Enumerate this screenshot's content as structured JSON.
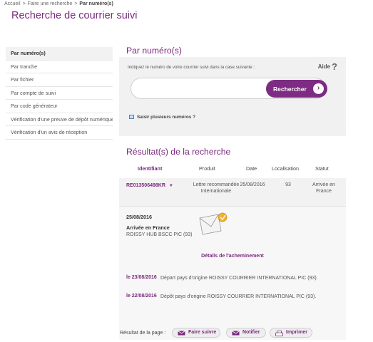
{
  "breadcrumb": {
    "items": [
      "Accueil",
      "Faire une recherche",
      "Par numéro(s)"
    ],
    "separator": ">"
  },
  "page": {
    "title": "Recherche de courrier suivi"
  },
  "sidebar": {
    "items": [
      {
        "label": "Par numéro(s)",
        "active": true
      },
      {
        "label": "Par tranche",
        "active": false
      },
      {
        "label": "Par fichier",
        "active": false
      },
      {
        "label": "Par compte de suivi",
        "active": false
      },
      {
        "label": "Par code générateur",
        "active": false
      },
      {
        "label": "Vérification d'une preuve de dépôt numérique",
        "active": false
      },
      {
        "label": "Vérification d'un avis de réception",
        "active": false
      }
    ]
  },
  "search": {
    "title": "Par numéro(s)",
    "hint": "Indiquez le numéro de votre courrier suivi dans la case suivante :",
    "help_label": "Aide",
    "help_icon": "?",
    "input_value": "",
    "input_placeholder": "",
    "button_label": "Rechercher",
    "button_icon": "chevron-right",
    "multi_label": "Saisir plusieurs numéros ?"
  },
  "results": {
    "title": "Résultat(s) de la recherche",
    "columns": {
      "id": "Identifiant",
      "product": "Produit",
      "date": "Date",
      "location": "Localisation",
      "status": "Statut"
    },
    "row": {
      "id": "RE013506498KR",
      "id_toggle": "▼",
      "product": "Lettre recommandée Internationale",
      "date": "25/08/2016",
      "location": "93",
      "status": "Arrivée en France"
    },
    "detail": {
      "date": "25/08/2016",
      "status": "Arrivée en France",
      "location": "ROISSY HUB BSCC PIC (93)",
      "link": "Détails de l'acheminement",
      "history": [
        {
          "date": "le 23/08/2016",
          "text": "Départ pays d'origine ROISSY COURRIER INTERNATIONAL PIC (93)."
        },
        {
          "date": "le 22/08/2016",
          "text": "Dépôt pays d'origine ROISSY COURRIER INTERNATIONAL PIC (93)."
        }
      ]
    }
  },
  "actions": {
    "label": "Résultat de la page :",
    "buttons": [
      {
        "label": "Faire suivre",
        "icon": "envelope-icon"
      },
      {
        "label": "Notifier",
        "icon": "envelope-icon"
      },
      {
        "label": "Imprimer",
        "icon": "printer-icon"
      }
    ]
  },
  "colors": {
    "brand": "#7a2a7e",
    "button": "#7d2b83",
    "panel": "#f1f1f1"
  }
}
